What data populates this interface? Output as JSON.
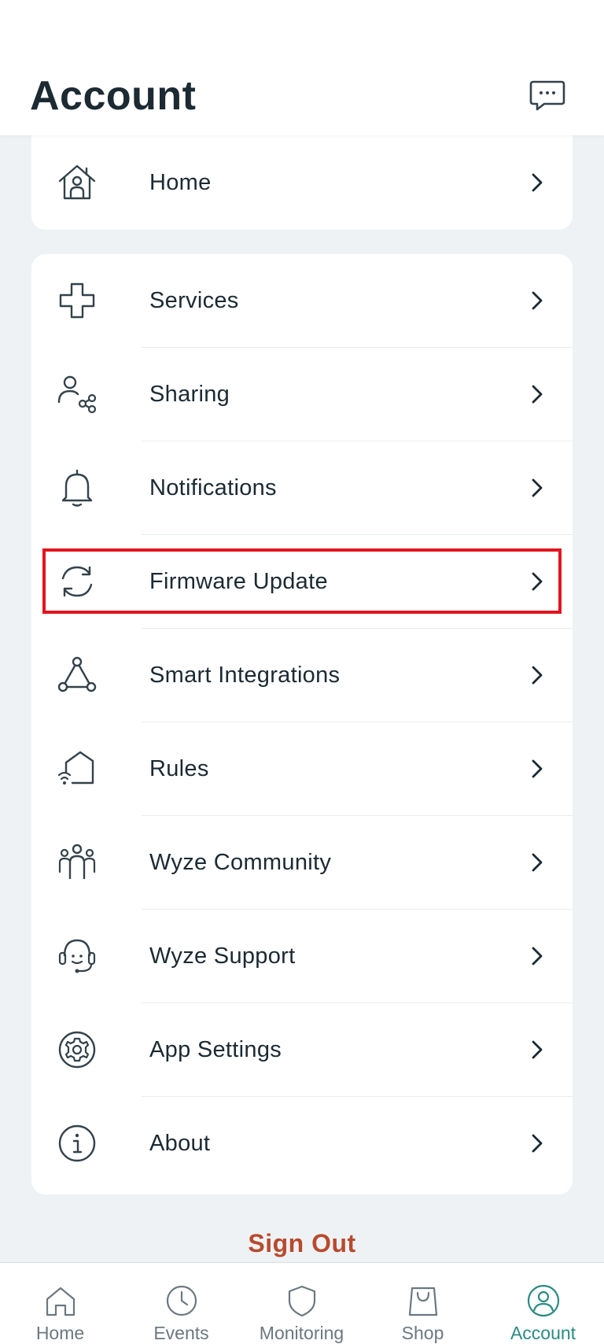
{
  "header": {
    "title": "Account",
    "chat_icon": "chat-bubble-icon"
  },
  "home_card": {
    "label": "Home",
    "icon": "home-person-icon"
  },
  "menu": [
    {
      "label": "Services",
      "icon": "plus-cross-icon"
    },
    {
      "label": "Sharing",
      "icon": "user-share-icon"
    },
    {
      "label": "Notifications",
      "icon": "bell-icon"
    },
    {
      "label": "Firmware Update",
      "icon": "refresh-icon",
      "highlighted": true
    },
    {
      "label": "Smart Integrations",
      "icon": "triangle-nodes-icon"
    },
    {
      "label": "Rules",
      "icon": "house-wifi-icon"
    },
    {
      "label": "Wyze Community",
      "icon": "community-icon"
    },
    {
      "label": "Wyze Support",
      "icon": "headset-icon"
    },
    {
      "label": "App Settings",
      "icon": "gear-icon"
    },
    {
      "label": "About",
      "icon": "info-icon"
    }
  ],
  "sign_out": "Sign Out",
  "tabs": [
    {
      "label": "Home",
      "icon": "home-icon"
    },
    {
      "label": "Events",
      "icon": "clock-icon"
    },
    {
      "label": "Monitoring",
      "icon": "shield-icon"
    },
    {
      "label": "Shop",
      "icon": "shopping-bag-icon"
    },
    {
      "label": "Account",
      "icon": "account-icon",
      "active": true
    }
  ],
  "colors": {
    "accent": "#2b8a83",
    "sign_out": "#b84a2e",
    "highlight": "#e2141f",
    "background": "#eff2f4"
  }
}
